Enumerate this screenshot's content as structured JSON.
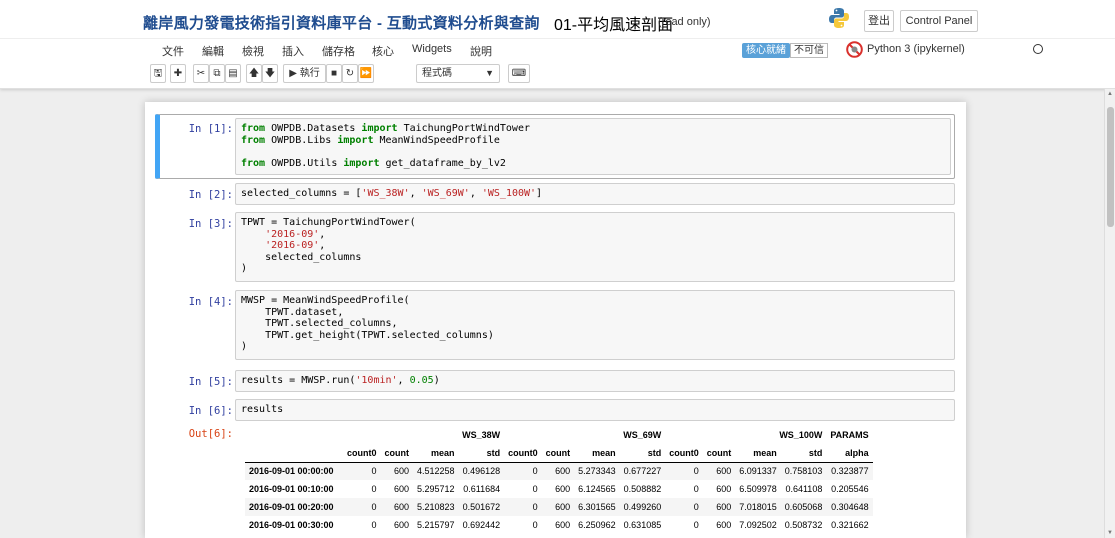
{
  "header": {
    "site_title": "離岸風力發電技術指引資料庫平台 - 互動式資料分析與查詢",
    "notebook_name": "01-平均風速剖面",
    "read_only": "(read only)",
    "logout_label": "登出",
    "control_panel_label": "Control Panel"
  },
  "menu": {
    "items": [
      "文件",
      "編輯",
      "檢視",
      "插入",
      "儲存格",
      "核心",
      "Widgets",
      "說明"
    ],
    "kernel_status": "核心就緒",
    "trusted": "不可信",
    "kernel_name": "Python 3 (ipykernel)"
  },
  "toolbar": {
    "run_label": "▶ 執行",
    "cell_type": "程式碼"
  },
  "cells": {
    "c1": {
      "prompt": "In [1]:"
    },
    "c2": {
      "prompt": "In [2]:"
    },
    "c3": {
      "prompt": "In [3]:"
    },
    "c4": {
      "prompt": "In [4]:"
    },
    "c5": {
      "prompt": "In [5]:"
    },
    "c6": {
      "prompt": "In [6]:",
      "out_prompt": "Out[6]:"
    }
  },
  "code": {
    "c1_l1_kw1": "from",
    "c1_l1_mod": " OWPDB.Datasets ",
    "c1_l1_kw2": "import",
    "c1_l1_name": " TaichungPortWindTower",
    "c1_l2_kw1": "from",
    "c1_l2_mod": " OWPDB.Libs ",
    "c1_l2_kw2": "import",
    "c1_l2_name": " MeanWindSpeedProfile",
    "c1_l3_kw1": "from",
    "c1_l3_mod": " OWPDB.Utils ",
    "c1_l3_kw2": "import",
    "c1_l3_name": " get_dataframe_by_lv2",
    "c2_pre": "selected_columns = [",
    "c2_s1": "'WS_38W'",
    "c2_sep1": ", ",
    "c2_s2": "'WS_69W'",
    "c2_sep2": ", ",
    "c2_s3": "'WS_100W'",
    "c2_post": "]",
    "c3_l1": "TPWT = TaichungPortWindTower(",
    "c3_l2": "'2016-09'",
    "c3_l2_end": ",",
    "c3_l3": "'2016-09'",
    "c3_l3_end": ",",
    "c3_l4": "    selected_columns",
    "c3_l5": ")",
    "c4_l1": "MWSP = MeanWindSpeedProfile(",
    "c4_l2": "    TPWT.dataset,",
    "c4_l3": "    TPWT.selected_columns,",
    "c4_l4": "    TPWT.get_height(TPWT.selected_columns)",
    "c4_l5": ")",
    "c5_pre": "results = MWSP.run(",
    "c5_str": "'10min'",
    "c5_sep": ", ",
    "c5_num": "0.05",
    "c5_post": ")",
    "c6": "results"
  },
  "dataframe": {
    "group_headers": [
      "WS_38W",
      "WS_69W",
      "WS_100W",
      "PARAMS"
    ],
    "sub_headers": [
      "count0",
      "count",
      "mean",
      "std",
      "count0",
      "count",
      "mean",
      "std",
      "count0",
      "count",
      "mean",
      "std",
      "alpha"
    ],
    "rows": [
      {
        "index": "2016-09-01 00:00:00",
        "values": [
          "0",
          "600",
          "4.512258",
          "0.496128",
          "0",
          "600",
          "5.273343",
          "0.677227",
          "0",
          "600",
          "6.091337",
          "0.758103",
          "0.323877"
        ]
      },
      {
        "index": "2016-09-01 00:10:00",
        "values": [
          "0",
          "600",
          "5.295712",
          "0.611684",
          "0",
          "600",
          "6.124565",
          "0.508882",
          "0",
          "600",
          "6.509978",
          "0.641108",
          "0.205546"
        ]
      },
      {
        "index": "2016-09-01 00:20:00",
        "values": [
          "0",
          "600",
          "5.210823",
          "0.501672",
          "0",
          "600",
          "6.301565",
          "0.499260",
          "0",
          "600",
          "7.018015",
          "0.605068",
          "0.304648"
        ]
      },
      {
        "index": "2016-09-01 00:30:00",
        "values": [
          "0",
          "600",
          "5.215797",
          "0.692442",
          "0",
          "600",
          "6.250962",
          "0.631085",
          "0",
          "600",
          "7.092502",
          "0.508732",
          "0.321662"
        ]
      }
    ]
  },
  "colors": {
    "title_blue": "#1f4c8f",
    "selected_cell_border": "#42a5f5",
    "in_prompt": "#303f9f",
    "out_prompt": "#d84315",
    "keyword": "#008000",
    "string": "#ba2121"
  }
}
